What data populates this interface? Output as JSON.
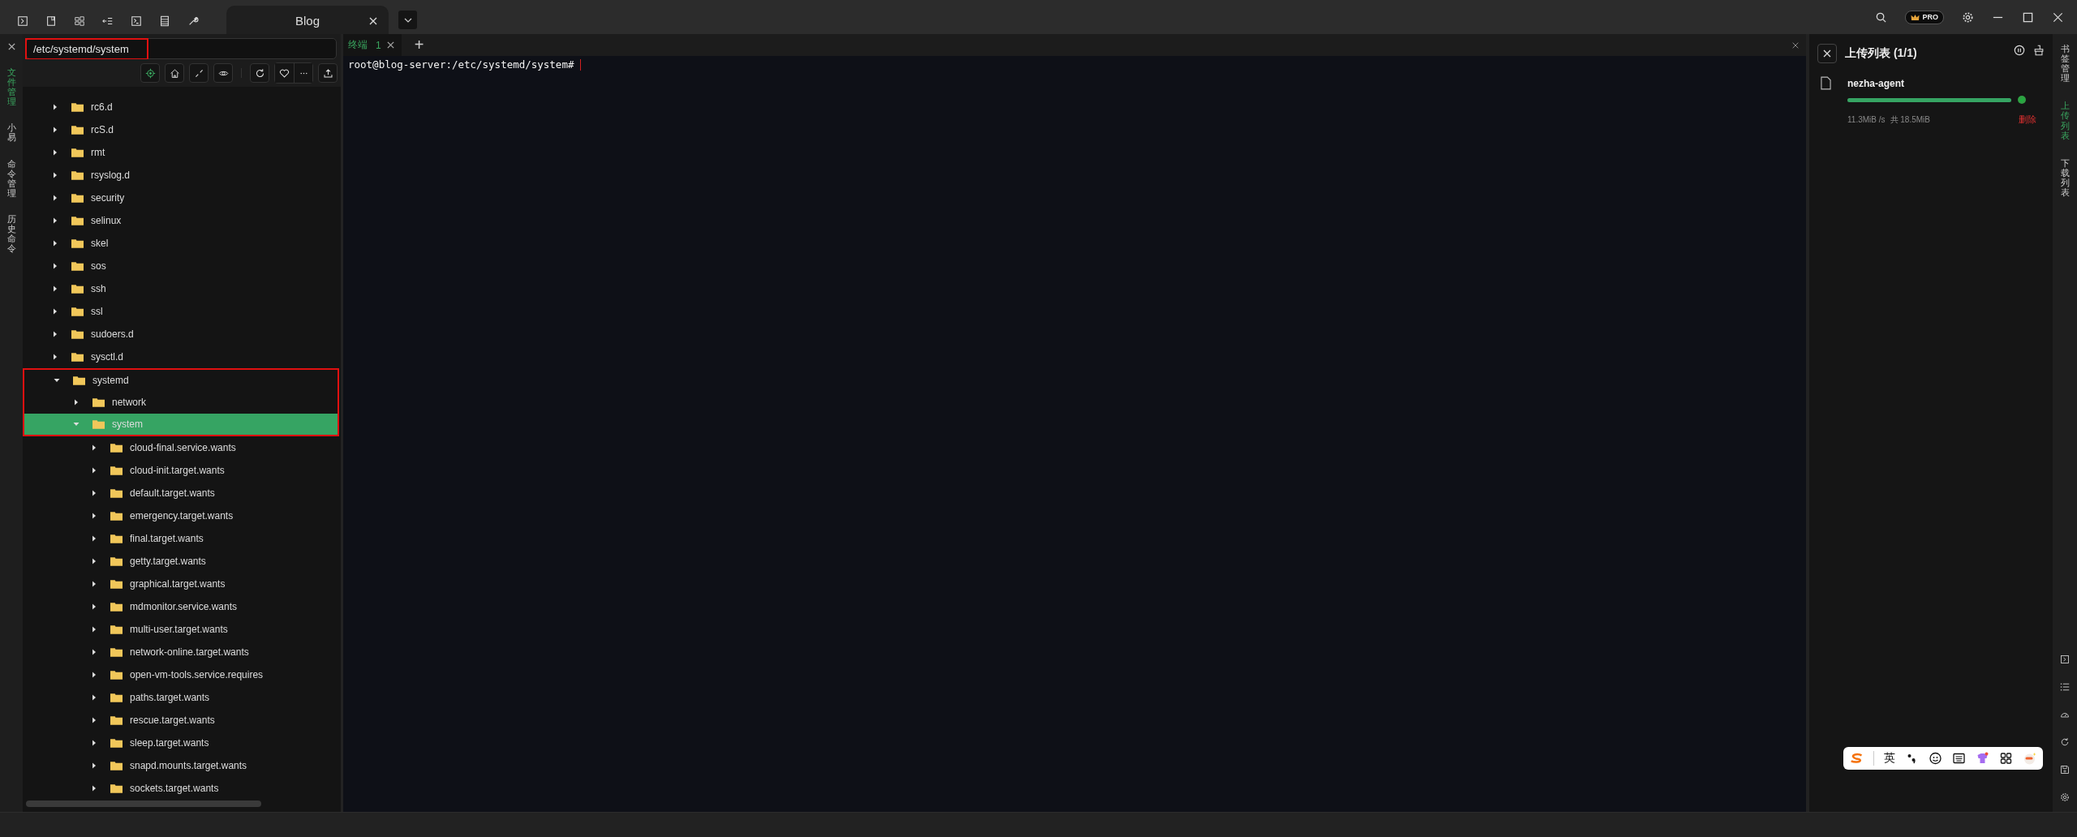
{
  "title_bar": {
    "tabs": [
      {
        "label": "Blog",
        "selected": true
      }
    ]
  },
  "left_rail": {
    "items": [
      {
        "label": "文件管理",
        "selected": true
      },
      {
        "label": "小易",
        "selected": false
      },
      {
        "label": "命令管理",
        "selected": false
      },
      {
        "label": "历史命令",
        "selected": false
      }
    ]
  },
  "file_panel": {
    "path": {
      "value": "/etc/systemd/system",
      "framed": true
    },
    "tree": [
      {
        "name": "rc6.d",
        "expanded": false,
        "selected": false,
        "framed": false
      },
      {
        "name": "rcS.d",
        "expanded": false,
        "selected": false,
        "framed": false
      },
      {
        "name": "rmt",
        "expanded": false,
        "selected": false,
        "framed": false
      },
      {
        "name": "rsyslog.d",
        "expanded": false,
        "selected": false,
        "framed": false
      },
      {
        "name": "security",
        "expanded": false,
        "selected": false,
        "framed": false
      },
      {
        "name": "selinux",
        "expanded": false,
        "selected": false,
        "framed": false
      },
      {
        "name": "skel",
        "expanded": false,
        "selected": false,
        "framed": false
      },
      {
        "name": "sos",
        "expanded": false,
        "selected": false,
        "framed": false
      },
      {
        "name": "ssh",
        "expanded": false,
        "selected": false,
        "framed": false
      },
      {
        "name": "ssl",
        "expanded": false,
        "selected": false,
        "framed": false
      },
      {
        "name": "sudoers.d",
        "expanded": false,
        "selected": false,
        "framed": false
      },
      {
        "name": "sysctl.d",
        "expanded": false,
        "selected": false,
        "framed": false
      },
      {
        "name": "systemd",
        "expanded": true,
        "selected": false,
        "framed": true,
        "children": [
          {
            "name": "network",
            "expanded": false,
            "selected": false,
            "framed": true
          },
          {
            "name": "system",
            "expanded": true,
            "selected": true,
            "framed": true,
            "children": [
              {
                "name": "cloud-final.service.wants",
                "expanded": false,
                "selected": false,
                "framed": false
              },
              {
                "name": "cloud-init.target.wants",
                "expanded": false,
                "selected": false,
                "framed": false
              },
              {
                "name": "default.target.wants",
                "expanded": false,
                "selected": false,
                "framed": false
              },
              {
                "name": "emergency.target.wants",
                "expanded": false,
                "selected": false,
                "framed": false
              },
              {
                "name": "final.target.wants",
                "expanded": false,
                "selected": false,
                "framed": false
              },
              {
                "name": "getty.target.wants",
                "expanded": false,
                "selected": false,
                "framed": false
              },
              {
                "name": "graphical.target.wants",
                "expanded": false,
                "selected": false,
                "framed": false
              },
              {
                "name": "mdmonitor.service.wants",
                "expanded": false,
                "selected": false,
                "framed": false
              },
              {
                "name": "multi-user.target.wants",
                "expanded": false,
                "selected": false,
                "framed": false
              },
              {
                "name": "network-online.target.wants",
                "expanded": false,
                "selected": false,
                "framed": false
              },
              {
                "name": "open-vm-tools.service.requires",
                "expanded": false,
                "selected": false,
                "framed": false
              },
              {
                "name": "paths.target.wants",
                "expanded": false,
                "selected": false,
                "framed": false
              },
              {
                "name": "rescue.target.wants",
                "expanded": false,
                "selected": false,
                "framed": false
              },
              {
                "name": "sleep.target.wants",
                "expanded": false,
                "selected": false,
                "framed": false
              },
              {
                "name": "snapd.mounts.target.wants",
                "expanded": false,
                "selected": false,
                "framed": false
              },
              {
                "name": "sockets.target.wants",
                "expanded": false,
                "selected": false,
                "framed": false
              }
            ]
          }
        ]
      }
    ]
  },
  "terminal": {
    "tabs": [
      {
        "label": "终端",
        "number": "1",
        "selected": true
      }
    ],
    "add": "+",
    "prompt": "root@blog-server:/etc/systemd/system#"
  },
  "upload_panel": {
    "title": "上传列表 (1/1)",
    "files": [
      {
        "name": "nezha-agent",
        "level": 1.0,
        "done": true,
        "speed": "11.3MiB /s",
        "total": "共 18.5MiB",
        "action": "删除"
      }
    ]
  },
  "right_rail": {
    "items": [
      {
        "label": "书签管理",
        "selected": false
      },
      {
        "label": "上传列表",
        "selected": true
      },
      {
        "label": "下载列表",
        "selected": false
      }
    ]
  },
  "pro_badge": "PRO",
  "ime_toolbar": {
    "mode": "英"
  }
}
